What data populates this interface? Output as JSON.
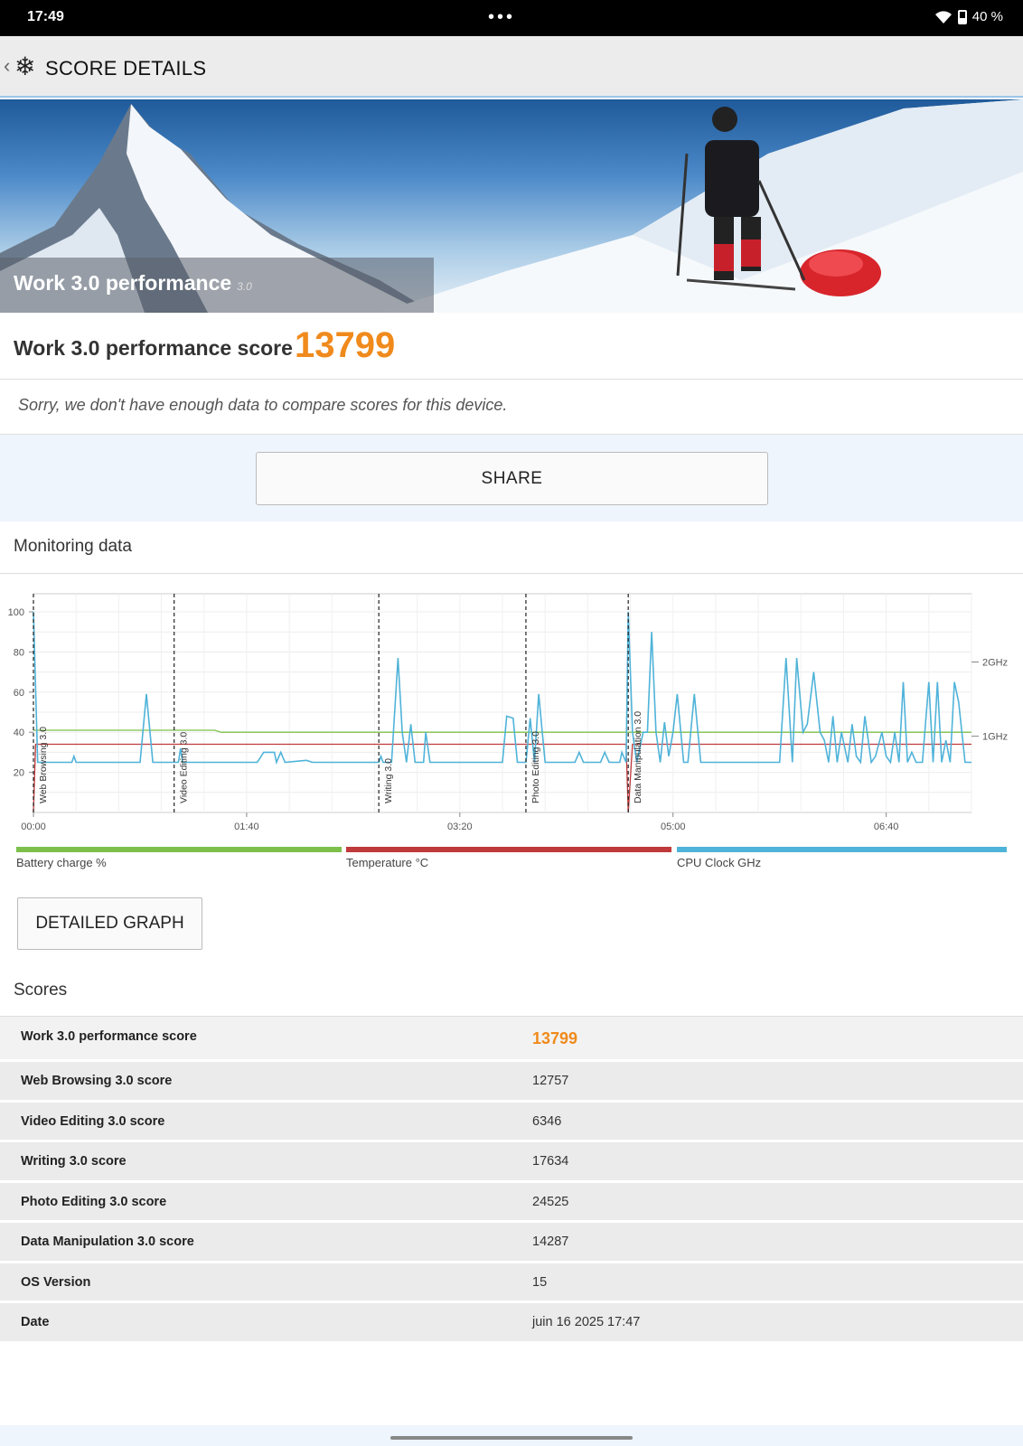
{
  "status": {
    "time": "17:49",
    "battery": "40 %"
  },
  "appbar": {
    "title": "SCORE DETAILS"
  },
  "banner": {
    "title": "Work 3.0 performance",
    "version": "3.0"
  },
  "score": {
    "label": "Work 3.0 performance score",
    "value": "13799",
    "note": "Sorry, we don't have enough data to compare scores for this device."
  },
  "share_label": "SHARE",
  "monitoring": {
    "title": "Monitoring data"
  },
  "chart_data": {
    "type": "line",
    "x_ticks": [
      "00:00",
      "01:40",
      "03:20",
      "05:00",
      "06:40"
    ],
    "y_ticks": [
      20,
      40,
      60,
      80,
      100
    ],
    "y_right_ticks": [
      "2GHz",
      "1GHz"
    ],
    "ylim": [
      0,
      100
    ],
    "xlim_seconds": [
      0,
      440
    ],
    "markers": [
      {
        "label": "Web Browsing 3.0",
        "t": 0
      },
      {
        "label": "Video Editing 3.0",
        "t": 66
      },
      {
        "label": "Writing 3.0",
        "t": 162
      },
      {
        "label": "Photo Editing 3.0",
        "t": 231
      },
      {
        "label": "Data Manipulation 3.0",
        "t": 279
      }
    ],
    "series": [
      {
        "name": "Battery charge %",
        "color": "#7cc04b",
        "points": [
          [
            0,
            41
          ],
          [
            85,
            41
          ],
          [
            88,
            40
          ],
          [
            440,
            40
          ]
        ]
      },
      {
        "name": "Temperature °C",
        "color": "#c0393b",
        "points": [
          [
            0,
            0
          ],
          [
            1,
            34
          ],
          [
            278,
            34
          ],
          [
            279,
            0
          ],
          [
            281,
            34
          ],
          [
            440,
            34
          ]
        ]
      },
      {
        "name": "CPU Clock GHz",
        "color": "#4fb3d9",
        "points": [
          [
            0,
            100
          ],
          [
            2,
            25
          ],
          [
            5,
            25
          ],
          [
            7,
            25
          ],
          [
            18,
            25
          ],
          [
            19,
            28
          ],
          [
            20,
            25
          ],
          [
            50,
            25
          ],
          [
            53,
            59
          ],
          [
            56,
            25
          ],
          [
            68,
            25
          ],
          [
            69,
            32
          ],
          [
            70,
            25
          ],
          [
            105,
            25
          ],
          [
            108,
            30
          ],
          [
            113,
            30
          ],
          [
            114,
            25
          ],
          [
            116,
            30
          ],
          [
            118,
            25
          ],
          [
            128,
            26
          ],
          [
            131,
            25
          ],
          [
            162,
            25
          ],
          [
            163,
            28
          ],
          [
            164,
            25
          ],
          [
            168,
            25
          ],
          [
            171,
            77
          ],
          [
            173,
            40
          ],
          [
            175,
            25
          ],
          [
            177,
            44
          ],
          [
            179,
            25
          ],
          [
            183,
            25
          ],
          [
            184,
            40
          ],
          [
            186,
            25
          ],
          [
            220,
            25
          ],
          [
            222,
            48
          ],
          [
            225,
            47
          ],
          [
            227,
            25
          ],
          [
            231,
            25
          ],
          [
            233,
            47
          ],
          [
            235,
            25
          ],
          [
            237,
            59
          ],
          [
            240,
            25
          ],
          [
            254,
            25
          ],
          [
            256,
            30
          ],
          [
            258,
            25
          ],
          [
            266,
            25
          ],
          [
            268,
            30
          ],
          [
            270,
            25
          ],
          [
            275,
            25
          ],
          [
            276,
            30
          ],
          [
            278,
            25
          ],
          [
            279,
            100
          ],
          [
            281,
            40
          ],
          [
            283,
            25
          ],
          [
            286,
            40
          ],
          [
            288,
            40
          ],
          [
            290,
            90
          ],
          [
            292,
            40
          ],
          [
            294,
            25
          ],
          [
            296,
            45
          ],
          [
            298,
            28
          ],
          [
            300,
            40
          ],
          [
            302,
            59
          ],
          [
            305,
            25
          ],
          [
            307,
            25
          ],
          [
            310,
            59
          ],
          [
            313,
            25
          ],
          [
            350,
            25
          ],
          [
            353,
            77
          ],
          [
            356,
            25
          ],
          [
            358,
            77
          ],
          [
            361,
            40
          ],
          [
            363,
            44
          ],
          [
            366,
            70
          ],
          [
            369,
            40
          ],
          [
            371,
            36
          ],
          [
            373,
            25
          ],
          [
            375,
            48
          ],
          [
            377,
            25
          ],
          [
            379,
            40
          ],
          [
            382,
            25
          ],
          [
            384,
            44
          ],
          [
            386,
            28
          ],
          [
            388,
            25
          ],
          [
            390,
            48
          ],
          [
            393,
            25
          ],
          [
            395,
            28
          ],
          [
            398,
            40
          ],
          [
            400,
            28
          ],
          [
            402,
            25
          ],
          [
            404,
            40
          ],
          [
            406,
            25
          ],
          [
            408,
            65
          ],
          [
            410,
            25
          ],
          [
            412,
            30
          ],
          [
            414,
            25
          ],
          [
            417,
            25
          ],
          [
            420,
            65
          ],
          [
            422,
            25
          ],
          [
            424,
            65
          ],
          [
            426,
            25
          ],
          [
            428,
            36
          ],
          [
            430,
            25
          ],
          [
            432,
            65
          ],
          [
            434,
            55
          ],
          [
            437,
            25
          ],
          [
            440,
            25
          ]
        ]
      }
    ]
  },
  "legend": [
    {
      "label": "Battery charge %",
      "color": "#7cc04b"
    },
    {
      "label": "Temperature °C",
      "color": "#c0393b"
    },
    {
      "label": "CPU Clock GHz",
      "color": "#4fb3d9"
    }
  ],
  "detailed_graph_label": "DETAILED GRAPH",
  "scores_title": "Scores",
  "scores": [
    {
      "k": "Work 3.0 performance score",
      "v": "13799"
    },
    {
      "k": "Web Browsing 3.0 score",
      "v": "12757"
    },
    {
      "k": "Video Editing 3.0 score",
      "v": "6346"
    },
    {
      "k": "Writing 3.0 score",
      "v": "17634"
    },
    {
      "k": "Photo Editing 3.0 score",
      "v": "24525"
    },
    {
      "k": "Data Manipulation 3.0 score",
      "v": "14287"
    },
    {
      "k": "OS Version",
      "v": "15"
    },
    {
      "k": "Date",
      "v": "juin 16 2025 17:47"
    }
  ]
}
